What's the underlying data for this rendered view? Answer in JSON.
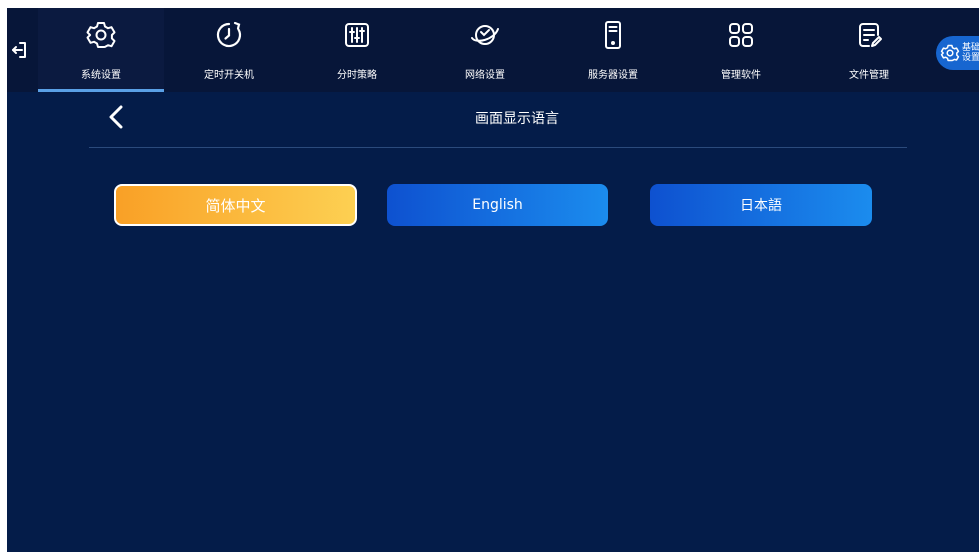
{
  "nav": {
    "items": [
      {
        "label": "系统设置",
        "icon": "gear-icon",
        "active": true
      },
      {
        "label": "定时开关机",
        "icon": "timer-clock-icon",
        "active": false
      },
      {
        "label": "分时策略",
        "icon": "sliders-icon",
        "active": false
      },
      {
        "label": "网络设置",
        "icon": "globe-network-icon",
        "active": false
      },
      {
        "label": "服务器设置",
        "icon": "server-icon",
        "active": false
      },
      {
        "label": "管理软件",
        "icon": "apps-grid-icon",
        "active": false
      },
      {
        "label": "文件管理",
        "icon": "file-edit-icon",
        "active": false
      }
    ],
    "base_settings_label": "基础设置"
  },
  "page": {
    "title": "画面显示语言"
  },
  "languages": [
    {
      "label": "简体中文",
      "selected": true
    },
    {
      "label": "English",
      "selected": false
    },
    {
      "label": "日本語",
      "selected": false
    }
  ],
  "colors": {
    "background": "#041c49",
    "nav_background": "#071639",
    "active_underline": "#5aa0e6",
    "selected_gradient_start": "#f9a026",
    "selected_gradient_end": "#fdd052",
    "button_gradient_start": "#0e51d0",
    "button_gradient_end": "#1b8cee",
    "divider": "#2b4a7c"
  }
}
